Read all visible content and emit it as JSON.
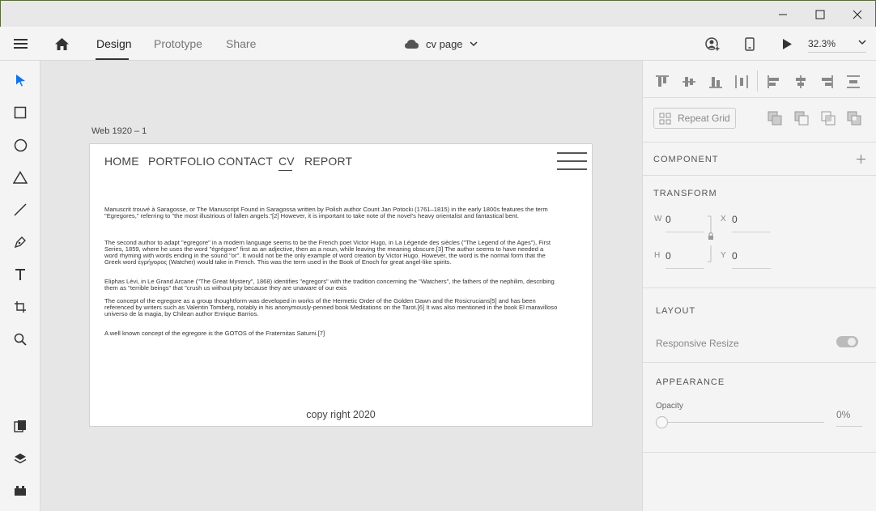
{
  "window": {
    "minimize_icon": "minimize-icon",
    "maximize_icon": "maximize-icon",
    "close_icon": "close-icon"
  },
  "toolbar": {
    "tabs": [
      {
        "label": "Design",
        "active": true
      },
      {
        "label": "Prototype",
        "active": false
      },
      {
        "label": "Share",
        "active": false
      }
    ],
    "document_name": "cv page",
    "zoom": "32.3%"
  },
  "artboard": {
    "name": "Web 1920 – 1",
    "nav": [
      "HOME",
      "PORTFOLIO",
      "CONTACT",
      "CV",
      "REPORT"
    ],
    "paragraphs": [
      "Manuscrit trouvé à Saragosse, or The Manuscript Found in Saragossa written by Polish author Count Jan Potocki (1761–1815) in the early 1800s features the term \"Egregores,\" referring to \"the most illustrious of fallen angels.\"[2] However, it is important to take note of the novel's heavy orientalist and fantastical bent.",
      "The second author to adapt \"egregore\" in a modern language seems to be the French poet Victor Hugo, in La Légende des siècles (\"The Legend of the Ages\"), First Series, 1859, where he uses the word \"égrégore\" first as an adjective, then as a noun, while leaving the meaning obscure.[3] The author seems to have needed a word rhyming with words ending in the sound \"or\". It would not be the only example of word creation by Victor Hugo. However, the word is the normal form that the Greek word ἐγρήγορος (Watcher) would take in French. This was the term used in the Book of Enoch for great angel-like spirits.",
      "Eliphas Lévi, in Le Grand Arcane (\"The Great Mystery\", 1868) identifies \"egregors\" with the tradition concerning the \"Watchers\", the fathers of the nephilim, describing them as \"terrible beings\" that \"crush us without pity because they are unaware of our exis",
      "The concept of the egregore as a group thoughtform was developed in works of the Hermetic Order of the Golden Dawn and the Rosicrucians[5] and has been referenced by writers such as Valentin Tomberg, notably in his anonymously-penned book Meditations on the Tarot.[6] It was also mentioned in the book El maravilloso universo de la magia, by Chilean author Enrique Barrios.",
      "A well known concept of the egregore is the GOTOS of the Fraternitas Saturni.[7]"
    ],
    "footer": "copy right 2020"
  },
  "panel": {
    "repeat_grid": "Repeat Grid",
    "component_title": "COMPONENT",
    "transform_title": "TRANSFORM",
    "w_label": "W",
    "w_value": "0",
    "x_label": "X",
    "x_value": "0",
    "h_label": "H",
    "h_value": "0",
    "y_label": "Y",
    "y_value": "0",
    "layout_title": "LAYOUT",
    "responsive_resize": "Responsive Resize",
    "responsive_resize_on": true,
    "appearance_title": "APPEARANCE",
    "opacity_label": "Opacity",
    "opacity_value": "0%",
    "opacity_fraction": 0
  },
  "colors": {
    "accent": "#1473e6",
    "active_tool": "#1473e6"
  }
}
